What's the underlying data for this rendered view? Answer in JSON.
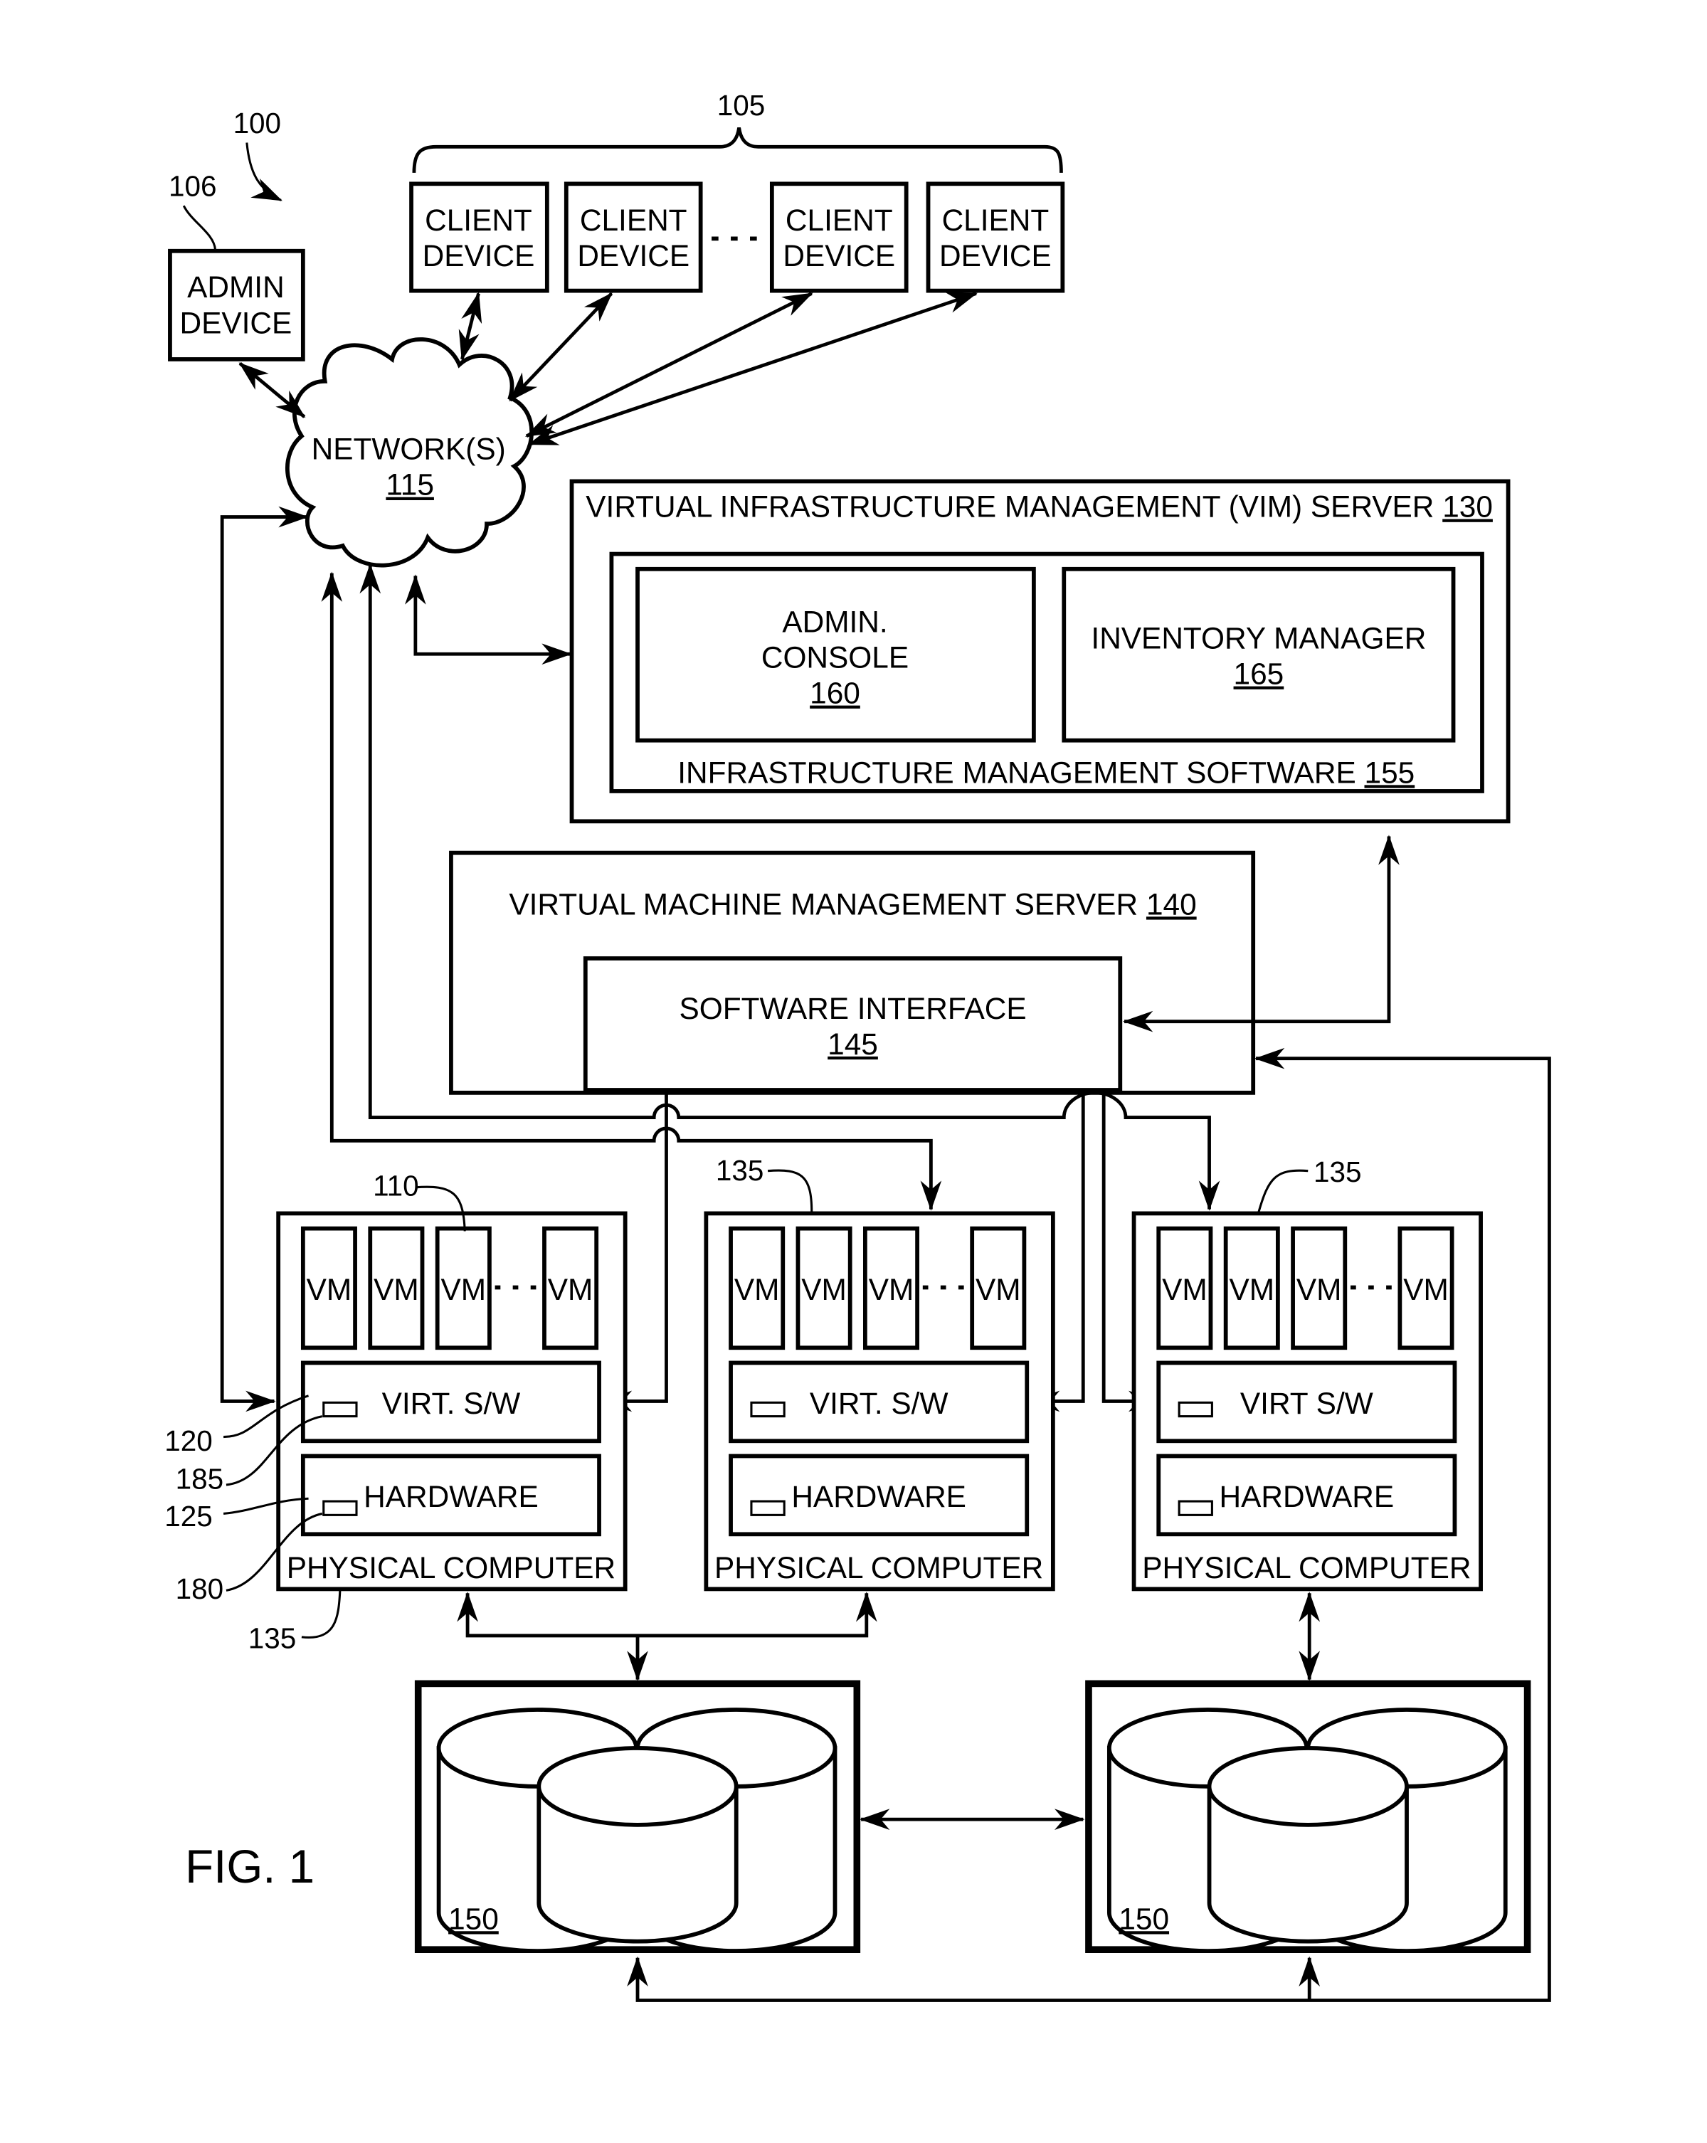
{
  "figure": {
    "label": "FIG. 1",
    "system_ref": "100"
  },
  "admin_device": {
    "line1": "ADMIN",
    "line2": "DEVICE",
    "ref": "106"
  },
  "client_devices": {
    "ref": "105",
    "items": [
      {
        "line1": "CLIENT",
        "line2": "DEVICE"
      },
      {
        "line1": "CLIENT",
        "line2": "DEVICE"
      },
      {
        "line1": "CLIENT",
        "line2": "DEVICE"
      },
      {
        "line1": "CLIENT",
        "line2": "DEVICE"
      }
    ]
  },
  "network": {
    "label": "NETWORK(S)",
    "ref": "115"
  },
  "vim_server": {
    "label": "VIRTUAL INFRASTRUCTURE MANAGEMENT (VIM) SERVER",
    "ref": "130",
    "software": {
      "label": "INFRASTRUCTURE MANAGEMENT SOFTWARE",
      "ref": "155"
    },
    "admin_console": {
      "line1": "ADMIN.",
      "line2": "CONSOLE",
      "ref": "160"
    },
    "inventory_manager": {
      "label": "INVENTORY MANAGER",
      "ref": "165"
    }
  },
  "vmm_server": {
    "label": "VIRTUAL MACHINE MANAGEMENT SERVER",
    "ref": "140",
    "software_interface": {
      "label": "SOFTWARE INTERFACE",
      "ref": "145"
    }
  },
  "physical_computers": [
    {
      "label": "PHYSICAL COMPUTER",
      "virt_label": "VIRT. S/W",
      "hw_label": "HARDWARE",
      "vm_label": "VM",
      "top_ref": "110",
      "bottom_ref": "135"
    },
    {
      "label": "PHYSICAL COMPUTER",
      "virt_label": "VIRT. S/W",
      "hw_label": "HARDWARE",
      "vm_label": "VM",
      "top_ref": "135"
    },
    {
      "label": "PHYSICAL COMPUTER",
      "virt_label": "VIRT S/W",
      "hw_label": "HARDWARE",
      "vm_label": "VM",
      "top_ref": "135"
    }
  ],
  "side_refs": {
    "virt_sw": "120",
    "virt_module": "185",
    "hardware": "125",
    "hw_module": "180"
  },
  "storage": [
    {
      "ref": "150"
    },
    {
      "ref": "150"
    }
  ]
}
